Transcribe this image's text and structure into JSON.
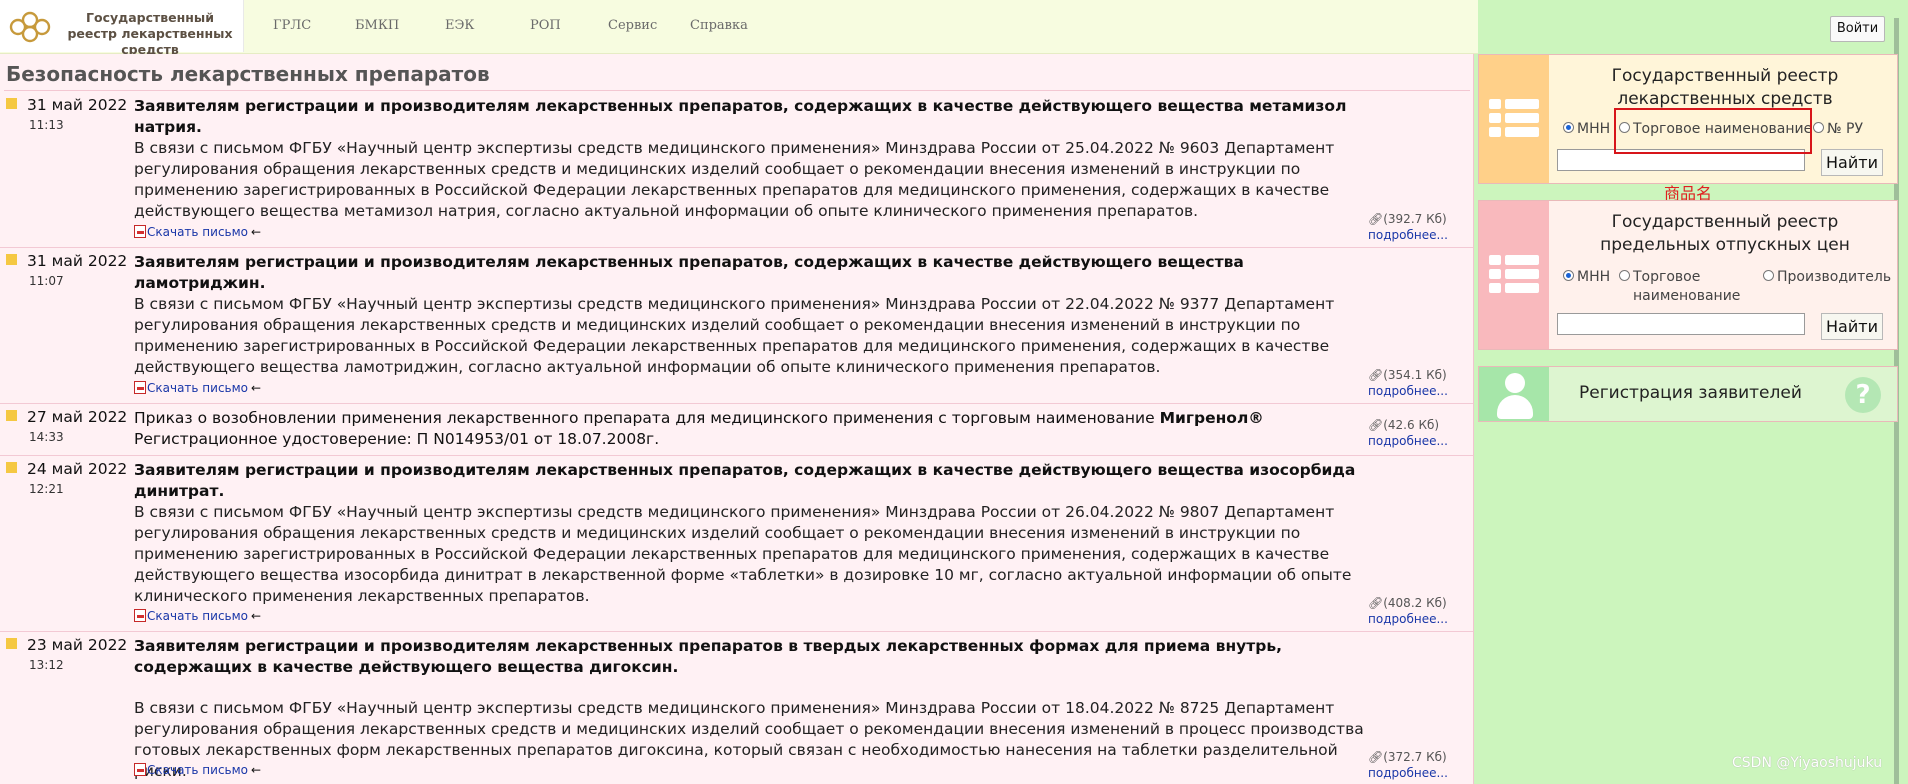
{
  "header": {
    "logo_text": "Государственный реестр лекарственных средств",
    "nav": [
      "ГРЛС",
      "БМКП",
      "ЕЭК",
      "РОП",
      "Сервис",
      "Справка"
    ],
    "login_label": "Войти"
  },
  "main": {
    "section_title": "Безопасность лекарственных препаратов",
    "news": [
      {
        "date": "31 май 2022",
        "time": "11:13",
        "headline": "Заявителям регистрации и производителям лекарственных препаратов, содержащих в качестве действующего вещества метамизол натрия.",
        "body": "В связи с письмом ФГБУ «Научный центр экспертизы средств медицинского применения» Минздрава России от 25.04.2022 № 9603 Департамент регулирования обращения лекарственных средств и медицинских изделий сообщает о рекомендации внесения изменений в инструкции по применению зарегистрированных в Российской Федерации лекарственных препаратов для медицинского применения, содержащих в качестве действующего вещества метамизол натрия, согласно актуальной информации об опыте клинического применения препаратов.",
        "download": "Скачать письмо",
        "size": "(392.7 Кб)",
        "more": "подробнее..."
      },
      {
        "date": "31 май 2022",
        "time": "11:07",
        "headline": "Заявителям регистрации и производителям лекарственных препаратов, содержащих в качестве действующего вещества ламотриджин.",
        "body": "В связи с письмом ФГБУ «Научный центр экспертизы средств медицинского применения» Минздрава России от 22.04.2022 № 9377 Департамент регулирования обращения лекарственных средств и медицинских изделий сообщает о рекомендации внесения изменений в инструкции по применению зарегистрированных в Российской Федерации лекарственных препаратов для медицинского применения, содержащих в качестве действующего вещества ламотриджин, согласно актуальной информации об опыте клинического применения препаратов.",
        "download": "Скачать письмо",
        "size": "(354.1 Кб)",
        "more": "подробнее..."
      },
      {
        "date": "27 май 2022",
        "time": "14:33",
        "headline": "Приказ о возобновлении применения лекарственного препарата для медицинского применения с торговым наименование",
        "headline_bold": "Мигренол®",
        "headline_line2": "Регистрационное удостоверение: П N014953/01 от 18.07.2008г.",
        "size": "(42.6 Кб)",
        "more": "подробнее..."
      },
      {
        "date": "24 май 2022",
        "time": "12:21",
        "headline": "Заявителям регистрации и производителям лекарственных препаратов, содержащих в качестве действующего вещества изосорбида динитрат.",
        "body": "В связи с письмом ФГБУ «Научный центр экспертизы средств медицинского применения» Минздрава России от 26.04.2022 № 9807 Департамент регулирования обращения лекарственных средств и медицинских изделий сообщает о рекомендации внесения изменений в инструкции по применению зарегистрированных в Российской Федерации лекарственных препаратов для медицинского применения, содержащих в качестве действующего вещества изосорбида динитрат в лекарственной форме «таблетки» в дозировке 10 мг, согласно актуальной информации об опыте клинического применения лекарственных препаратов.",
        "download": "Скачать письмо",
        "size": "(408.2 Кб)",
        "more": "подробнее..."
      },
      {
        "date": "23 май 2022",
        "time": "13:12",
        "headline": "Заявителям регистрации и производителям лекарственных препаратов в твердых лекарственных формах для приема внутрь, содержащих в качестве действующего вещества дигоксин.",
        "body": "В связи с письмом ФГБУ «Научный центр экспертизы средств медицинского применения» Минздрава России от 18.04.2022 № 8725 Департамент регулирования обращения лекарственных средств и медицинских изделий сообщает о рекомендации внесения изменений в процесс производства готовых лекарственных форм лекарственных препаратов дигоксина, который связан с необходимостью нанесения на таблетки разделительной риски.",
        "download": "Скачать письмо",
        "size": "(372.7 Кб)",
        "more": "подробнее..."
      }
    ]
  },
  "sidebar": {
    "grls": {
      "title": "Государственный реестр лекарственных средств",
      "radios": [
        "МНН",
        "Торговое наименование",
        "№ РУ"
      ],
      "selected": "МНН",
      "search_value": "",
      "button": "Найти"
    },
    "prices": {
      "title": "Государственный реестр предельных отпускных цен",
      "radios": [
        "МНН",
        "Торговое",
        "наименование",
        "Производитель"
      ],
      "selected": "МНН",
      "search_value": "",
      "button": "Найти"
    },
    "registration": {
      "label": "Регистрация заявителей",
      "help": "?"
    },
    "annotation": "商品名"
  },
  "watermark": "CSDN @Yiyaoshujuku"
}
